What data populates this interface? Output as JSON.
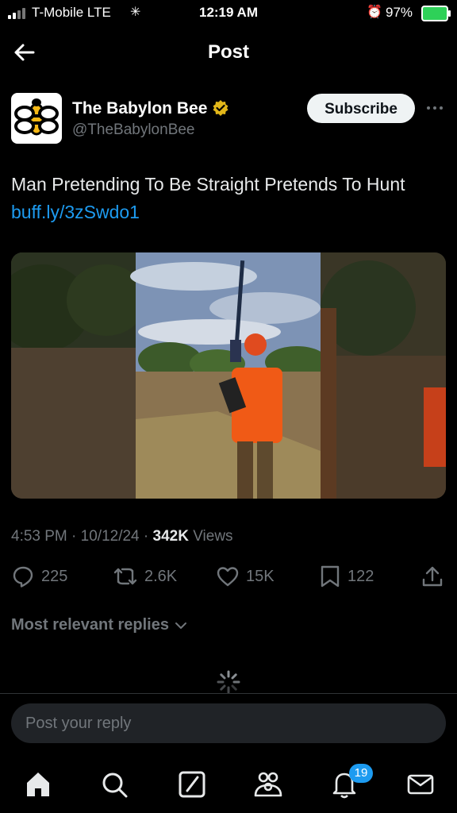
{
  "status_bar": {
    "carrier": "T-Mobile  LTE",
    "time": "12:19 AM",
    "battery": "97%"
  },
  "header": {
    "title": "Post"
  },
  "author": {
    "name": "The Babylon Bee",
    "handle": "@TheBabylonBee",
    "subscribe_label": "Subscribe"
  },
  "post": {
    "text": "Man Pretending To Be Straight Pretends To Hunt",
    "link": "buff.ly/3zSwdo1",
    "time": "4:53 PM",
    "date": "10/12/24",
    "views_count": "342K",
    "views_label": "Views"
  },
  "actions": {
    "replies": "225",
    "reposts": "2.6K",
    "likes": "15K",
    "bookmarks": "122"
  },
  "replies_sort": "Most relevant replies",
  "reply_placeholder": "Post your reply",
  "notifications_badge": "19",
  "colors": {
    "accent": "#1d9bf0",
    "verified": "#e2b719",
    "battery": "#2ed158"
  }
}
